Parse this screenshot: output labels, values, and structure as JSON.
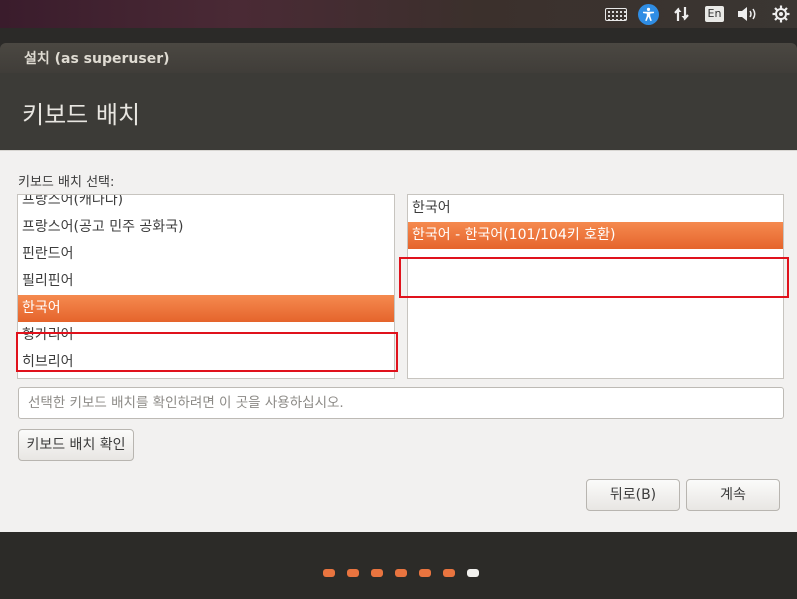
{
  "top_panel": {
    "indicators": [
      {
        "icon": "keyboard-icon"
      },
      {
        "icon": "accessibility-icon"
      },
      {
        "icon": "network-icon"
      },
      {
        "icon": "language-indicator",
        "label": "En"
      },
      {
        "icon": "volume-icon"
      },
      {
        "icon": "power-settings-icon"
      }
    ]
  },
  "window": {
    "title": "설치 (as superuser)",
    "heading": "키보드 배치"
  },
  "layout_section": {
    "label": "키보드 배치 선택:",
    "languages": [
      {
        "label": "프랑스어(캐나다)",
        "selected": false
      },
      {
        "label": "프랑스어(공고 민주 공화국)",
        "selected": false
      },
      {
        "label": "핀란드어",
        "selected": false
      },
      {
        "label": "필리핀어",
        "selected": false
      },
      {
        "label": "한국어",
        "selected": true
      },
      {
        "label": "헝가리어",
        "selected": false
      },
      {
        "label": "히브리어",
        "selected": false
      }
    ],
    "variants": [
      {
        "label": "한국어",
        "selected": false
      },
      {
        "label": "한국어 - 한국어(101/104키 호환)",
        "selected": true
      }
    ]
  },
  "test_field": {
    "placeholder": "선택한 키보드 배치를 확인하려면 이 곳을 사용하십시오."
  },
  "buttons": {
    "detect": "키보드 배치 확인",
    "back": "뒤로(B)",
    "continue": "계속"
  },
  "progress": {
    "total_steps": 7,
    "current_step": 7
  },
  "colors": {
    "accent": "#E95420",
    "annotation": "#E0121C"
  }
}
